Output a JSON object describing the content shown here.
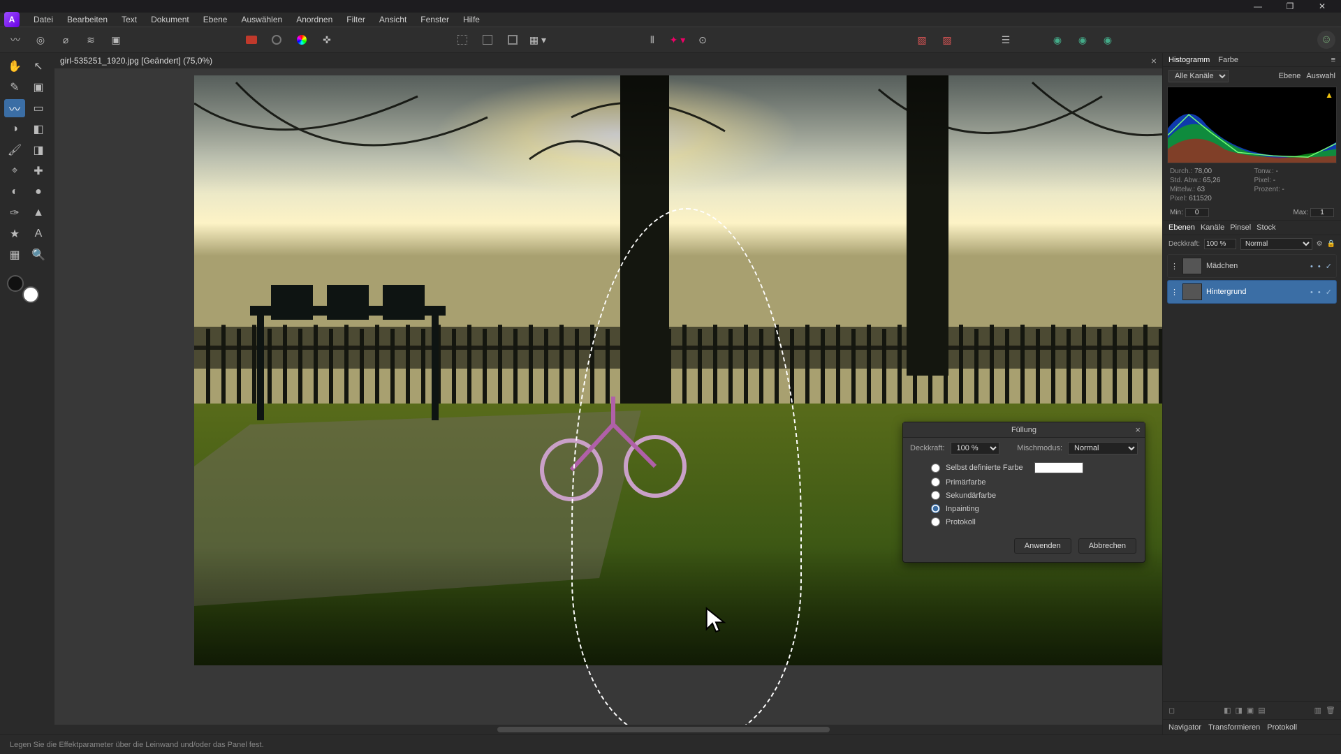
{
  "menu": [
    "Datei",
    "Bearbeiten",
    "Text",
    "Dokument",
    "Ebene",
    "Auswählen",
    "Anordnen",
    "Filter",
    "Ansicht",
    "Fenster",
    "Hilfe"
  ],
  "document": {
    "tab_label": "girl-535251_1920.jpg [Geändert] (75,0%)"
  },
  "histogram": {
    "tab_hist": "Histogramm",
    "tab_color": "Farbe",
    "channel_sel": "Alle Kanäle",
    "btn_layer": "Ebene",
    "btn_sel": "Auswahl",
    "stat_durch_lbl": "Durch.:",
    "stat_durch": "78,00",
    "stat_std_lbl": "Std. Abw.:",
    "stat_std": "65,26",
    "stat_mittel_lbl": "Mittelw.:",
    "stat_mittel": "63",
    "stat_pix_lbl": "Pixel:",
    "stat_pix": "611520",
    "stat_tonw_lbl": "Tonw.:",
    "stat_tonw": "-",
    "stat_pixel2_lbl": "Pixel:",
    "stat_pixel2": "-",
    "stat_proz_lbl": "Prozent:",
    "stat_proz": "-",
    "min_lbl": "Min:",
    "min": "0",
    "max_lbl": "Max:",
    "max": "1"
  },
  "layers_panel": {
    "tabs": [
      "Ebenen",
      "Kanäle",
      "Pinsel",
      "Stock"
    ],
    "opacity_lbl": "Deckkraft:",
    "opacity": "100 %",
    "blend": "Normal",
    "layers": [
      {
        "name": "Mädchen",
        "sel": false
      },
      {
        "name": "Hintergrund",
        "sel": true
      }
    ]
  },
  "dialog": {
    "title": "Füllung",
    "opacity_lbl": "Deckkraft:",
    "opacity": "100 %",
    "blend_lbl": "Mischmodus:",
    "blend": "Normal",
    "opts": [
      "Selbst definierte Farbe",
      "Primärfarbe",
      "Sekundärfarbe",
      "Inpainting",
      "Protokoll"
    ],
    "selected": 3,
    "apply": "Anwenden",
    "cancel": "Abbrechen"
  },
  "bottom_tabs": [
    "Navigator",
    "Transformieren",
    "Protokoll"
  ],
  "status": "Legen Sie die Effektparameter über die Leinwand und/oder das Panel fest.",
  "colors": {
    "accent": "#3b6ea5"
  }
}
